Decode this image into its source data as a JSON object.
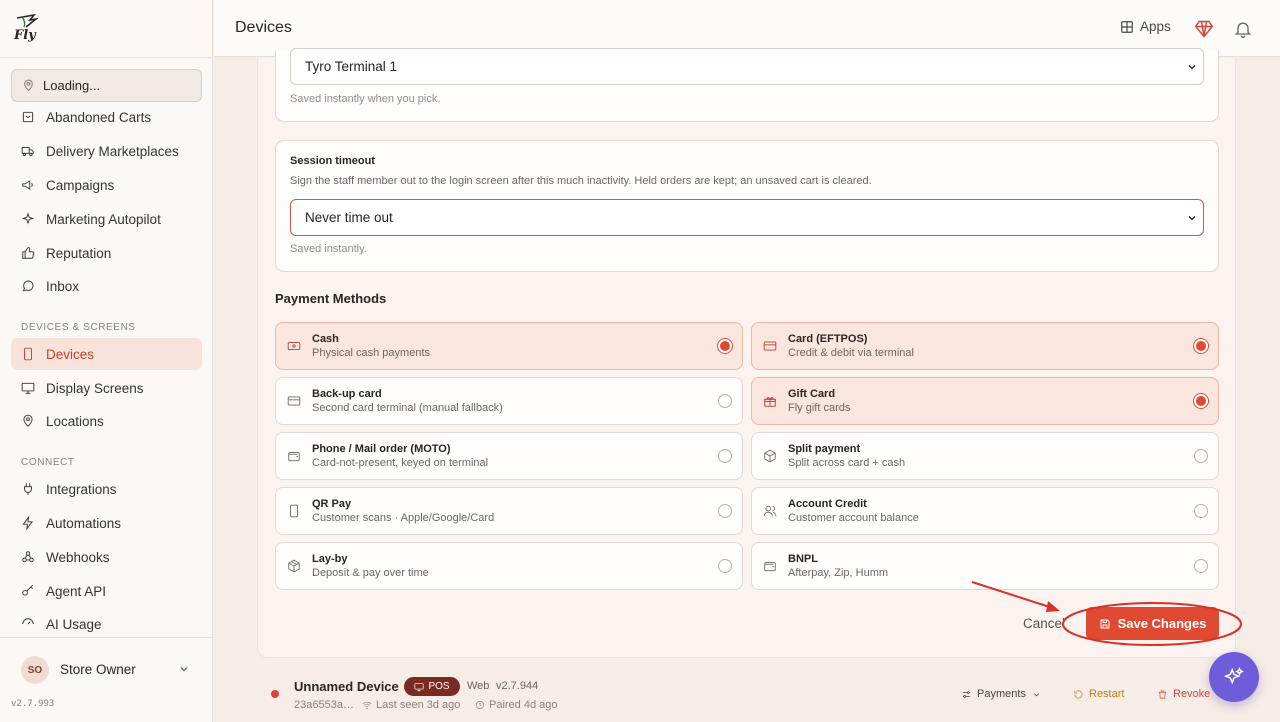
{
  "app": {
    "logo_text": "Fly",
    "version": "v2.7.993"
  },
  "header": {
    "title": "Devices",
    "apps_label": "Apps",
    "icons": [
      "grid-icon",
      "gem-icon",
      "bell-icon"
    ]
  },
  "sidebar": {
    "location_label": "Loading...",
    "items": [
      {
        "label": "Abandoned Carts",
        "icon": "cart-icon"
      },
      {
        "label": "Delivery Marketplaces",
        "icon": "truck-icon"
      },
      {
        "label": "Campaigns",
        "icon": "megaphone-icon"
      },
      {
        "label": "Marketing Autopilot",
        "icon": "sparkle-icon"
      },
      {
        "label": "Reputation",
        "icon": "thumbs-up-icon"
      },
      {
        "label": "Inbox",
        "icon": "chat-icon"
      }
    ],
    "section_devices": "DEVICES & SCREENS",
    "device_items": [
      {
        "label": "Devices",
        "icon": "phone-icon",
        "active": true
      },
      {
        "label": "Display Screens",
        "icon": "monitor-icon"
      },
      {
        "label": "Locations",
        "icon": "pin-icon"
      }
    ],
    "section_connect": "CONNECT",
    "connect_items": [
      {
        "label": "Integrations",
        "icon": "plug-icon"
      },
      {
        "label": "Automations",
        "icon": "bolt-icon"
      },
      {
        "label": "Webhooks",
        "icon": "webhook-icon"
      },
      {
        "label": "Agent API",
        "icon": "key-icon"
      },
      {
        "label": "AI Usage",
        "icon": "gauge-icon"
      }
    ],
    "user": {
      "initials": "SO",
      "name": "Store Owner"
    }
  },
  "terminal": {
    "value": "Tyro Terminal 1",
    "hint": "Saved instantly when you pick."
  },
  "session": {
    "title": "Session timeout",
    "description": "Sign the staff member out to the login screen after this much inactivity. Held orders are kept; an unsaved cart is cleared.",
    "value": "Never time out",
    "hint": "Saved instantly."
  },
  "payment_methods": {
    "heading": "Payment Methods",
    "items": [
      {
        "title": "Cash",
        "desc": "Physical cash payments",
        "icon": "cash-icon",
        "selected": true
      },
      {
        "title": "Card (EFTPOS)",
        "desc": "Credit & debit via terminal",
        "icon": "card-icon",
        "selected": true
      },
      {
        "title": "Back-up card",
        "desc": "Second card terminal (manual fallback)",
        "icon": "card-icon",
        "selected": false
      },
      {
        "title": "Gift Card",
        "desc": "Fly gift cards",
        "icon": "gift-icon",
        "selected": true
      },
      {
        "title": "Phone / Mail order (MOTO)",
        "desc": "Card-not-present, keyed on terminal",
        "icon": "wallet-icon",
        "selected": false
      },
      {
        "title": "Split payment",
        "desc": "Split across card + cash",
        "icon": "box-icon",
        "selected": false
      },
      {
        "title": "QR Pay",
        "desc": "Customer scans · Apple/Google/Card",
        "icon": "phone-icon",
        "selected": false
      },
      {
        "title": "Account Credit",
        "desc": "Customer account balance",
        "icon": "users-icon",
        "selected": false
      },
      {
        "title": "Lay-by",
        "desc": "Deposit & pay over time",
        "icon": "package-icon",
        "selected": false
      },
      {
        "title": "BNPL",
        "desc": "Afterpay, Zip, Humm",
        "icon": "wallet-icon",
        "selected": false
      }
    ]
  },
  "actions": {
    "cancel_label": "Cancel",
    "save_label": "Save Changes"
  },
  "device": {
    "name": "Unnamed Device",
    "badge": "POS",
    "platform": "Web",
    "version": "v2.7.944",
    "id": "23a6553a…",
    "last_seen": "Last seen 3d ago",
    "paired": "Paired 4d ago",
    "payments_label": "Payments",
    "restart_label": "Restart",
    "revoke_label": "Revoke",
    "status_color": "#d9453a"
  },
  "colors": {
    "accent": "#e04a32",
    "fab": "#6e5cd9"
  }
}
